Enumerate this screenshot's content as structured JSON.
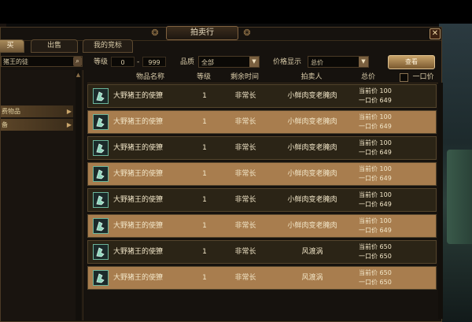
{
  "window": {
    "title": "拍卖行",
    "close_glyph": "✕"
  },
  "tabs": [
    {
      "label": "买",
      "active": true
    },
    {
      "label": "出售",
      "active": false
    },
    {
      "label": "我的竞标",
      "active": false
    }
  ],
  "filters": {
    "search_value": "猪王的徒",
    "level_label": "等级",
    "level_min": "0",
    "level_dash": "-",
    "level_max": "999",
    "quality_label": "品质",
    "quality_value": "全部",
    "price_display_label": "价格显示",
    "price_display_value": "总价",
    "search_button_label": "查看"
  },
  "categories": [
    {
      "label": "费物品"
    },
    {
      "label": "备"
    }
  ],
  "table": {
    "headers": {
      "name": "物品名称",
      "level": "等级",
      "time": "剩余时间",
      "seller": "拍卖人",
      "price": "总价",
      "buyout_label": "一口价"
    },
    "rows": [
      {
        "name": "大野猪王的使獠",
        "level": "1",
        "time": "非常长",
        "seller": "小鲜肉变老腌肉",
        "bid": "当前价 100",
        "buyout": "一口价 649"
      },
      {
        "name": "大野猪王的使獠",
        "level": "1",
        "time": "非常长",
        "seller": "小鲜肉变老腌肉",
        "bid": "当前价 100",
        "buyout": "一口价 649"
      },
      {
        "name": "大野猪王的使獠",
        "level": "1",
        "time": "非常长",
        "seller": "小鲜肉变老腌肉",
        "bid": "当前价 100",
        "buyout": "一口价 649"
      },
      {
        "name": "大野猪王的使獠",
        "level": "1",
        "time": "非常长",
        "seller": "小鲜肉变老腌肉",
        "bid": "当前价 100",
        "buyout": "一口价 649"
      },
      {
        "name": "大野猪王的使獠",
        "level": "1",
        "time": "非常长",
        "seller": "小鲜肉变老腌肉",
        "bid": "当前价 100",
        "buyout": "一口价 649"
      },
      {
        "name": "大野猪王的使獠",
        "level": "1",
        "time": "非常长",
        "seller": "小鲜肉变老腌肉",
        "bid": "当前价 100",
        "buyout": "一口价 649"
      },
      {
        "name": "大野猪王的使獠",
        "level": "1",
        "time": "非常长",
        "seller": "风渡涡",
        "bid": "当前价 650",
        "buyout": "一口价 650"
      },
      {
        "name": "大野猪王的使獠",
        "level": "1",
        "time": "非常长",
        "seller": "风渡涡",
        "bid": "当前价 650",
        "buyout": "一口价 650"
      }
    ]
  },
  "icons": {
    "item": "green-boar-tusk-icon",
    "search": "search-icon",
    "dropdown": "chevron-down-icon"
  },
  "colors": {
    "row_dark": "#2b2416",
    "row_light": "#a87d4e",
    "accent": "#c9a46a"
  }
}
